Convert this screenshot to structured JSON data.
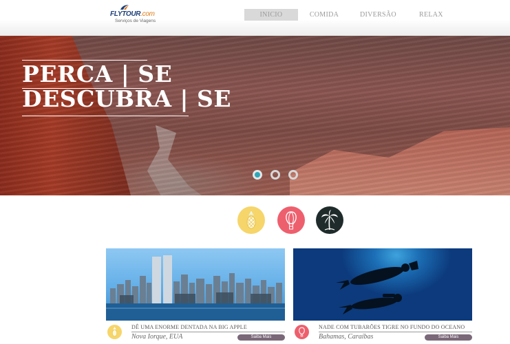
{
  "brand": {
    "name": "FLYTOUR",
    "suffix": ".com",
    "tagline": "Serviços de Viagens"
  },
  "nav": {
    "items": [
      {
        "label": "INICIO",
        "active": true
      },
      {
        "label": "COMIDA",
        "active": false
      },
      {
        "label": "DIVERSÃO",
        "active": false
      },
      {
        "label": "RELAX",
        "active": false
      }
    ]
  },
  "hero": {
    "line1": "PERCA | SE",
    "line2": "DESCUBRA | SE",
    "slides": 3,
    "active_slide": 1
  },
  "categories": [
    {
      "icon": "pineapple-icon",
      "color": "#f6d56a"
    },
    {
      "icon": "hot-air-balloon-icon",
      "color": "#ee5f6d"
    },
    {
      "icon": "palm-tree-icon",
      "color": "#1f2b2b"
    }
  ],
  "cards": [
    {
      "title": "DÊ UMA ENORME DENTADA NA BIG APPLE",
      "location": "Nova Iorque, EUA",
      "button": "Saiba Mais",
      "badge_icon": "pineapple-icon",
      "badge_color": "#f6d56a"
    },
    {
      "title": "NADE COM TUBARÕES TIGRE NO FUNDO DO OCEANO",
      "location": "Bahamas, Caraíbas",
      "button": "Saiba Mais",
      "badge_icon": "hot-air-balloon-icon",
      "badge_color": "#ee5f6d"
    }
  ],
  "colors": {
    "accent": "#2fa6b8",
    "button": "#7a6879",
    "brand_blue": "#1d3f7a",
    "brand_orange": "#e07b1a"
  }
}
